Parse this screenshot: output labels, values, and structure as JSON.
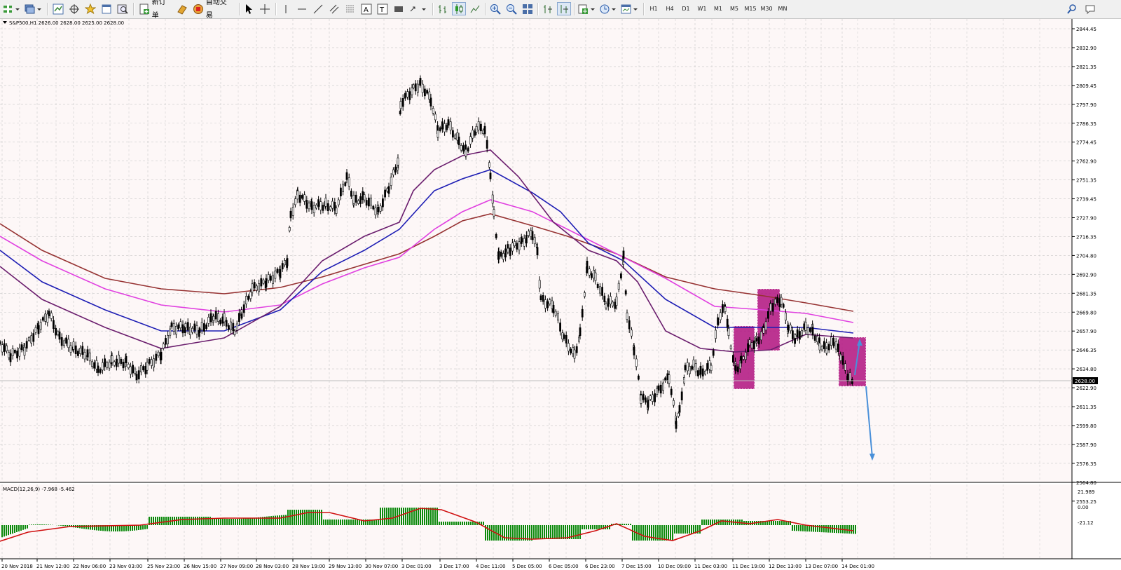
{
  "toolbar": {
    "new_order_label": "新订单",
    "auto_trading_label": "自动交易",
    "timeframes": [
      "H1",
      "H4",
      "D1",
      "W1",
      "M1",
      "M5",
      "M15",
      "M30",
      "MN"
    ],
    "active_timeframe": "H1"
  },
  "chart": {
    "symbol_info": "S&P500,H1  2626.00 2628.00 2625.00 2628.00",
    "current_price": "2628.00",
    "macd_info": "MACD(12,26,9) -7.968 -5.462",
    "price_ticks": [
      "2844.45",
      "2832.90",
      "2821.35",
      "2809.45",
      "2797.90",
      "2786.35",
      "2774.45",
      "2762.90",
      "2751.35",
      "2739.45",
      "2727.90",
      "2716.35",
      "2704.80",
      "2692.90",
      "2681.35",
      "2669.80",
      "2657.90",
      "2646.35",
      "2634.80",
      "2622.90",
      "2611.35",
      "2599.80",
      "2587.90",
      "2576.35",
      "2564.80",
      "2553.25"
    ],
    "macd_ticks": [
      "21.989",
      "0.00",
      "-21.12"
    ],
    "time_ticks": [
      "20 Nov 2018",
      "21 Nov 12:00",
      "22 Nov 06:00",
      "23 Nov 03:00",
      "25 Nov 23:00",
      "26 Nov 15:00",
      "27 Nov 09:00",
      "28 Nov 03:00",
      "28 Nov 19:00",
      "29 Nov 13:00",
      "30 Nov 07:00",
      "3 Dec 01:00",
      "3 Dec 17:00",
      "4 Dec 11:00",
      "5 Dec 05:00",
      "6 Dec 05:00",
      "6 Dec 23:00",
      "7 Dec 15:00",
      "10 Dec 09:00",
      "11 Dec 03:00",
      "11 Dec 19:00",
      "12 Dec 13:00",
      "13 Dec 07:00",
      "14 Dec 01:00"
    ],
    "colors": {
      "background": "#fdf7f7",
      "grid": "#c8c8c8",
      "candle": "#000000",
      "ma_fast": "#6b1e6e",
      "ma_mid": "#1d1db4",
      "ma_slow": "#e040e0",
      "ma_long": "#963232",
      "highlight_box": "#b0127f",
      "arrow": "#4a90d9",
      "macd_hist": "#0c8a0c",
      "macd_signal": "#d01010"
    }
  }
}
